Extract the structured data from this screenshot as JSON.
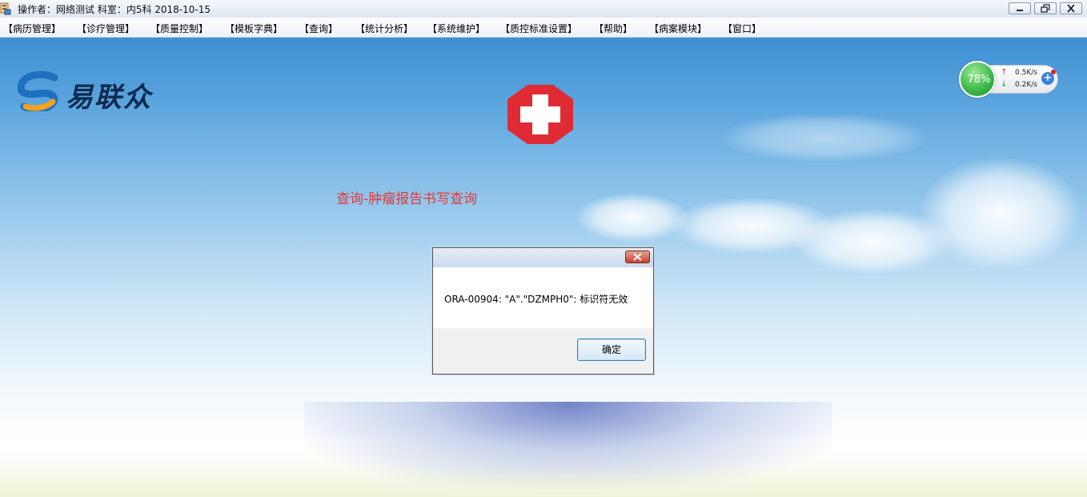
{
  "window": {
    "title": "操作者：网络测试  科室：内5科   2018-10-15",
    "controls": [
      "minimize-icon",
      "restore-icon",
      "close-icon"
    ]
  },
  "menu": [
    "【病历管理】",
    "【诊疗管理】",
    "【质量控制】",
    "【模板字典】",
    "【查询】",
    "【统计分析】",
    "【系统维护】",
    "【质控标准设置】",
    "【帮助】",
    "【病案模块】",
    "【窗口】"
  ],
  "desktop": {
    "logo_text": "易联众",
    "query_label": "查询-肿瘤报告书写查询",
    "colors": {
      "sky": "#4a96d6",
      "cross": "#e02b35",
      "label": "#e03a3a"
    }
  },
  "netmeter": {
    "percent": "78%",
    "up": "0.5K/s",
    "down": "0.2K/s"
  },
  "dialog": {
    "message": "ORA-00904: \"A\".\"DZMPH0\": 标识符无效",
    "ok_label": "确定"
  }
}
